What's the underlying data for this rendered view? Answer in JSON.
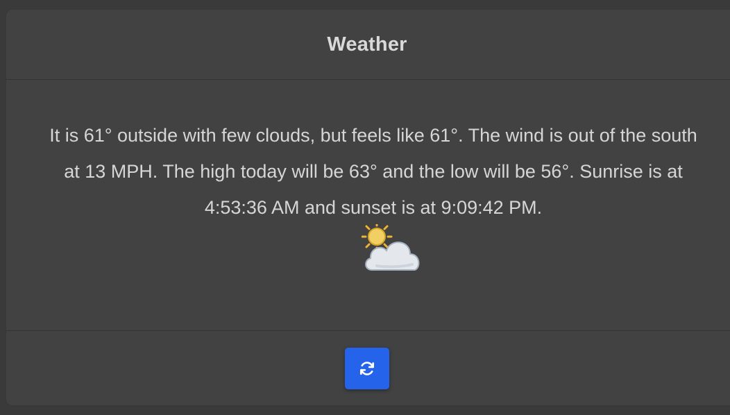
{
  "card": {
    "title": "Weather",
    "body_text": "It is 61° outside with few clouds, but feels like 61°. The wind is out of the south at 13 MPH. The high today will be 63° and the low will be 56°. Sunrise is at 4:53:36 AM and sunset is at 9:09:42 PM.",
    "weather_icon": "sun-behind-cloud-icon"
  },
  "footer": {
    "refresh_icon": "refresh-icon"
  },
  "colors": {
    "page_background": "#3a3a3a",
    "card_background": "#424242",
    "text": "#d6d6d6",
    "button": "#2563eb"
  }
}
